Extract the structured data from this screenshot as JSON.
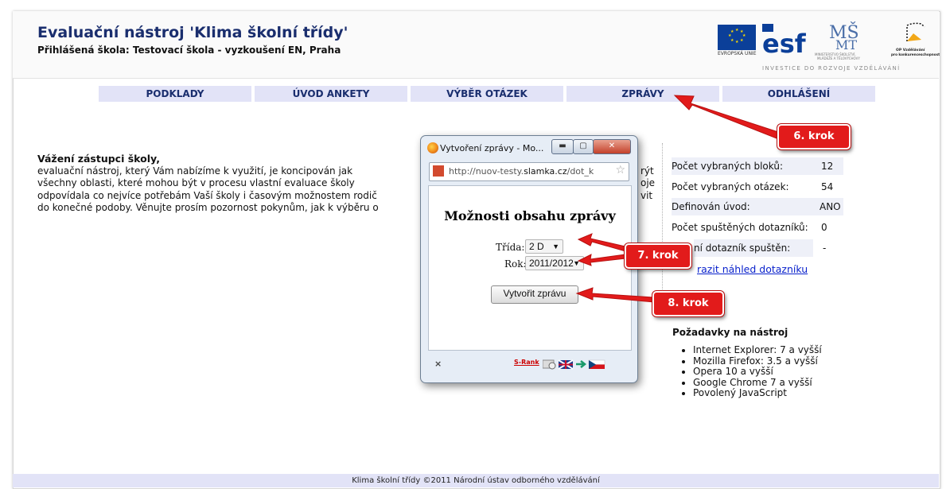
{
  "header": {
    "title": "Evaluační nástroj 'Klima školní třídy'",
    "school_line": "Přihlášená škola: Testovací škola - vyzkoušení EN, Praha",
    "eu_caption": "EVROPSKÁ UNIE",
    "msmt_caption": "MINISTERSTVO ŠKOLSTVÍ, MLÁDEŽE A TĚLOVÝCHOVY",
    "op_caption": "OP Vzdělávání pro konkurenceschopnost",
    "investice": "INVESTICE DO ROZVOJE VZDĚLÁVÁNÍ"
  },
  "nav": {
    "items": [
      {
        "label": "PODKLADY"
      },
      {
        "label": "ÚVOD ANKETY"
      },
      {
        "label": "VÝBĚR OTÁZEK"
      },
      {
        "label": "ZPRÁVY"
      },
      {
        "label": "ODHLÁŠENÍ"
      }
    ]
  },
  "content": {
    "greeting": "Vážení zástupci školy,",
    "line1": "evaluační nástroj, který Vám nabízíme k využití, je koncipován jak",
    "line1_end": "rýt",
    "line2": "všechny oblasti, které mohou být v procesu vlastní evaluace školy",
    "line2_end": "oje",
    "line3": "odpovídala co nejvíce potřebám Vaší školy i časovým možnostem rodič",
    "line3_end": "vit",
    "line4": "do konečné podoby. Věnujte prosím pozornost pokynům, jak k výběru o"
  },
  "stats": [
    {
      "label": "Počet vybraných bloků:",
      "value": "12"
    },
    {
      "label": "Počet vybraných otázek:",
      "value": "54"
    },
    {
      "label": "Definován úvod:",
      "value": "ANO"
    },
    {
      "label": "Počet spuštěných dotazníků:",
      "value": "0"
    },
    {
      "label": "ní dotazník spuštěn:",
      "value": "-"
    }
  ],
  "preview_link": "razit náhled dotazníku",
  "requirements": {
    "title": "Požadavky na nástroj",
    "items": [
      "Internet Explorer: 7 a vyšší",
      "Mozilla Firefox: 3.5 a vyšší",
      "Opera 10 a vyšší",
      "Google Chrome 7 a vyšší",
      "Povolený JavaScript"
    ]
  },
  "footer": "Klima školní třídy ©2011 Národní ústav odborného vzdělávání",
  "popup": {
    "title": "Vytvoření zprávy - Mo...",
    "url_prefix": "http://nuov-testy.",
    "url_domain": "slamka.cz",
    "url_suffix": "/dot_k",
    "heading": "Možnosti obsahu zprávy",
    "class_label": "Třída:",
    "class_value": "2 D",
    "year_label": "Rok:",
    "year_value": "2011/2012",
    "button": "Vytvořit zprávu",
    "srank": "S-Rank",
    "close": "×"
  },
  "callouts": {
    "step6": "6. krok",
    "step7": "7. krok",
    "step8": "8. krok"
  },
  "colors": {
    "accent_red": "#e21b1b",
    "nav_bg": "#e2e3f7",
    "title_blue": "#1a2e6e"
  }
}
